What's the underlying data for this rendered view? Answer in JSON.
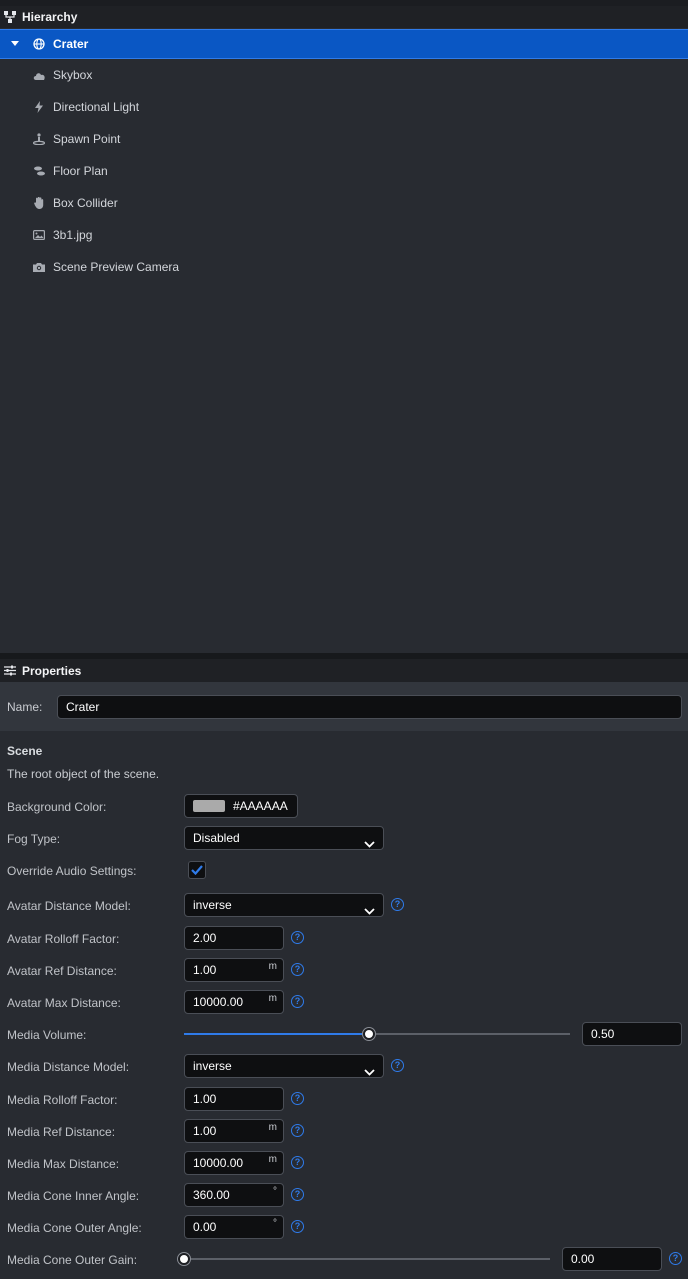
{
  "colors": {
    "accent": "#0a57c4",
    "help": "#2f7bea",
    "swatch": "#AAAAAA"
  },
  "hierarchy": {
    "title": "Hierarchy",
    "root": {
      "label": "Crater",
      "icon": "globe-icon"
    },
    "children": [
      {
        "label": "Skybox",
        "icon": "cloud-icon"
      },
      {
        "label": "Directional Light",
        "icon": "bolt-icon"
      },
      {
        "label": "Spawn Point",
        "icon": "spawn-icon"
      },
      {
        "label": "Floor Plan",
        "icon": "shoe-prints-icon"
      },
      {
        "label": "Box Collider",
        "icon": "hand-icon"
      },
      {
        "label": "3b1.jpg",
        "icon": "image-icon"
      },
      {
        "label": "Scene Preview Camera",
        "icon": "camera-icon"
      }
    ]
  },
  "properties": {
    "title": "Properties",
    "name_label": "Name:",
    "name_value": "Crater",
    "section_title": "Scene",
    "section_desc": "The root object of the scene.",
    "background_color": {
      "label": "Background Color:",
      "value": "#AAAAAA"
    },
    "fog_type": {
      "label": "Fog Type:",
      "value": "Disabled"
    },
    "override_audio": {
      "label": "Override Audio Settings:",
      "checked": true
    },
    "avatar_distance_model": {
      "label": "Avatar Distance Model:",
      "value": "inverse"
    },
    "avatar_rolloff": {
      "label": "Avatar Rolloff Factor:",
      "value": "2.00"
    },
    "avatar_ref_distance": {
      "label": "Avatar Ref Distance:",
      "value": "1.00",
      "unit": "m"
    },
    "avatar_max_distance": {
      "label": "Avatar Max Distance:",
      "value": "10000.00",
      "unit": "m"
    },
    "media_volume": {
      "label": "Media Volume:",
      "value": "0.50",
      "level": 0.5
    },
    "media_distance_model": {
      "label": "Media Distance Model:",
      "value": "inverse"
    },
    "media_rolloff": {
      "label": "Media Rolloff Factor:",
      "value": "1.00"
    },
    "media_ref_distance": {
      "label": "Media Ref Distance:",
      "value": "1.00",
      "unit": "m"
    },
    "media_max_distance": {
      "label": "Media Max Distance:",
      "value": "10000.00",
      "unit": "m"
    },
    "media_cone_inner": {
      "label": "Media Cone Inner Angle:",
      "value": "360.00",
      "unit": "°"
    },
    "media_cone_outer": {
      "label": "Media Cone Outer Angle:",
      "value": "0.00",
      "unit": "°"
    },
    "media_cone_outer_gain": {
      "label": "Media Cone Outer Gain:",
      "value": "0.00",
      "level": 0
    }
  },
  "help_glyph": "?"
}
